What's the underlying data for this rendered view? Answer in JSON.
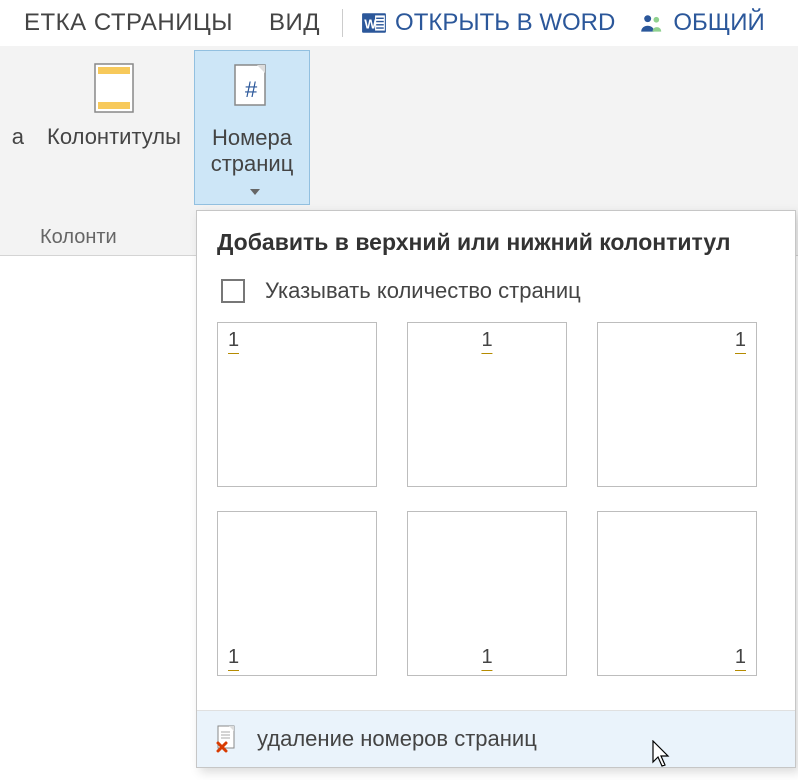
{
  "tabs": {
    "page_layout": "ЕТКА СТРАНИЦЫ",
    "view": "ВИД",
    "open_in_word": "ОТКРЫТЬ В WORD",
    "share": "ОБЩИЙ"
  },
  "ribbon": {
    "partial_left_label": "а",
    "headers_footers_label": "Колонтитулы",
    "page_numbers_line1": "Номера",
    "page_numbers_line2": "страниц",
    "group_label": "Колонти"
  },
  "dropdown": {
    "title": "Добавить в верхний или нижний колонтитул",
    "include_count_label": "Указывать количество страниц",
    "sample_page_number": "1",
    "remove_label": "удаление номеров страниц"
  }
}
